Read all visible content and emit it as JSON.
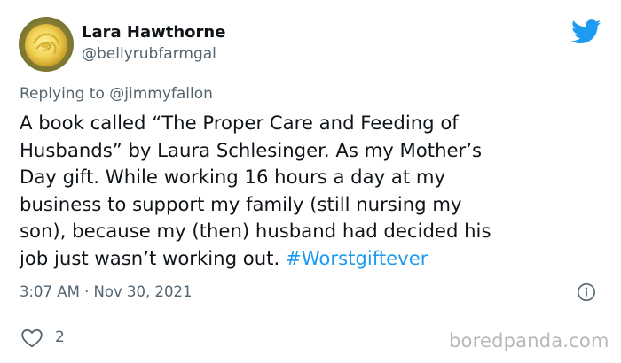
{
  "user": {
    "display_name": "Lara Hawthorne",
    "handle": "@bellyrubfarmgal",
    "avatar": "yellow-rose-avatar"
  },
  "reply": {
    "prefix": "Replying to ",
    "mention": "@jimmyfallon"
  },
  "tweet": {
    "lines": [
      "A book called “The Proper Care and Feeding of",
      "Husbands” by Laura Schlesinger.  As my Mother’s",
      "Day gift. While working 16 hours a day at my",
      "business to support my family (still nursing my",
      "son), because my (then) husband had decided his",
      "job just wasn’t working out. "
    ],
    "hashtag": "#Worstgiftever"
  },
  "meta": {
    "timestamp": "3:07 AM · Nov 30, 2021"
  },
  "actions": {
    "like_count": "2"
  },
  "watermark": "boredpanda.com",
  "icons": {
    "brand": "twitter-bird-icon",
    "info": "info-icon",
    "like": "heart-icon"
  },
  "colors": {
    "twitter_blue": "#1d9bf0",
    "text": "#0f1419",
    "secondary": "#536471"
  }
}
